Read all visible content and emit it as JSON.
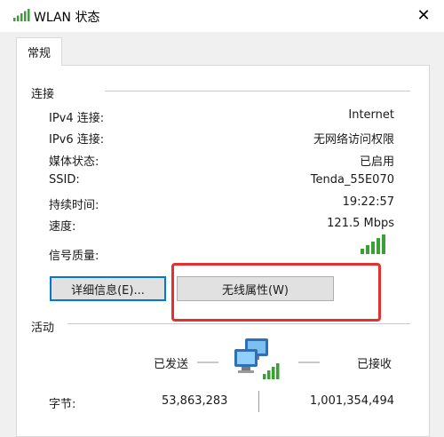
{
  "window": {
    "title": "WLAN 状态",
    "close_glyph": "✕"
  },
  "tabs": [
    {
      "label": "常规"
    }
  ],
  "connection": {
    "section_title": "连接",
    "rows": [
      {
        "label": "IPv4 连接:",
        "value": "Internet"
      },
      {
        "label": "IPv6 连接:",
        "value": "无网络访问权限"
      },
      {
        "label": "媒体状态:",
        "value": "已启用"
      },
      {
        "label": "SSID:",
        "value": "Tenda_55E070"
      },
      {
        "label": "持续时间:",
        "value": "19:22:57"
      },
      {
        "label": "速度:",
        "value": "121.5 Mbps"
      }
    ],
    "signal_label": "信号质量:",
    "signal_bars_lit": 5,
    "signal_bars_total": 5,
    "details_button": "详细信息(E)...",
    "wireless_props_button": "无线属性(W)"
  },
  "activity": {
    "section_title": "活动",
    "sent_label": "已发送",
    "received_label": "已接收",
    "bytes_label": "字节:",
    "bytes_sent": "53,863,283",
    "bytes_received": "1,001,354,494"
  },
  "colors": {
    "accent": "#0078d7",
    "highlight": "#e53030",
    "signal": "#3aa034"
  }
}
